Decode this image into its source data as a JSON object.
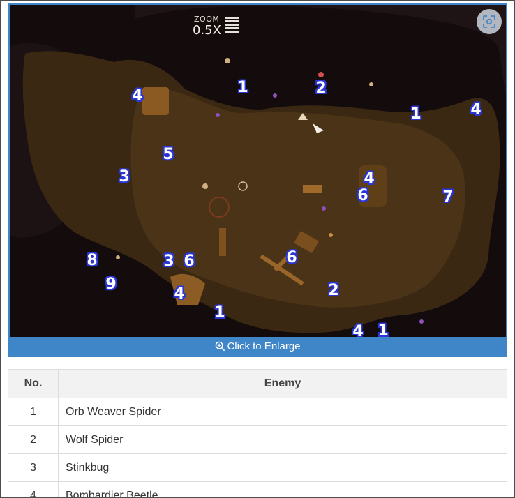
{
  "map": {
    "zoom_label": "ZOOM",
    "zoom_value": "0.5X",
    "enlarge_label": "Click to Enlarge",
    "scan_icon": "scan-icon",
    "markers": [
      "4",
      "1",
      "2",
      "1",
      "4",
      "5",
      "3",
      "4",
      "6",
      "7",
      "8",
      "3",
      "6",
      "6",
      "9",
      "4",
      "2",
      "1",
      "4",
      "1"
    ]
  },
  "table": {
    "headers": {
      "no": "No.",
      "enemy": "Enemy"
    },
    "rows": [
      {
        "no": "1",
        "enemy": "Orb Weaver Spider"
      },
      {
        "no": "2",
        "enemy": "Wolf Spider"
      },
      {
        "no": "3",
        "enemy": "Stinkbug"
      },
      {
        "no": "4",
        "enemy": "Bombardier Beetle"
      }
    ]
  }
}
